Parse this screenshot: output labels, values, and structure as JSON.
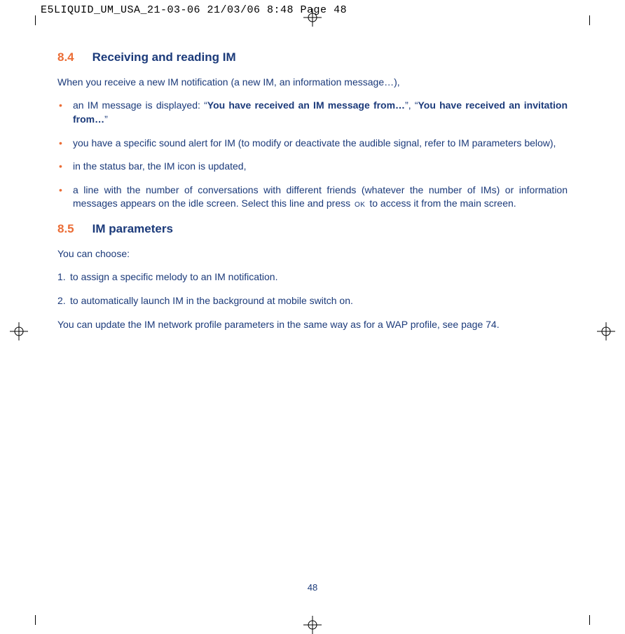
{
  "slug": "E5LIQUID_UM_USA_21-03-06  21/03/06  8:48  Page 48",
  "page_number": "48",
  "section_84": {
    "num": "8.4",
    "title": "Receiving and reading IM",
    "intro": "When you receive a new IM notification (a new IM, an information message…),",
    "bullets": {
      "b1_pre": "an IM message is displayed: “",
      "b1_bold1": "You have received an IM message from…",
      "b1_mid": "”, “",
      "b1_bold2": "You have received an invitation from…",
      "b1_post": "”",
      "b2": "you have a specific sound alert for IM (to modify or deactivate the audible signal, refer to IM parameters below),",
      "b3": "in the status bar, the IM icon is updated,",
      "b4_pre": "a line with the number of conversations with different friends (whatever the number of IMs) or information messages appears on the idle screen. Select this line and press ",
      "b4_ok": "OK",
      "b4_post": " to access it from the main screen."
    }
  },
  "section_85": {
    "num": "8.5",
    "title": "IM parameters",
    "intro": "You can choose:",
    "items": {
      "n1": "1.",
      "t1": "to assign a specific melody to an IM notification.",
      "n2": "2.",
      "t2": "to automatically launch IM in the background at mobile switch on."
    },
    "outro": "You can update the IM network profile parameters in the same way as for a WAP profile, see page 74."
  }
}
